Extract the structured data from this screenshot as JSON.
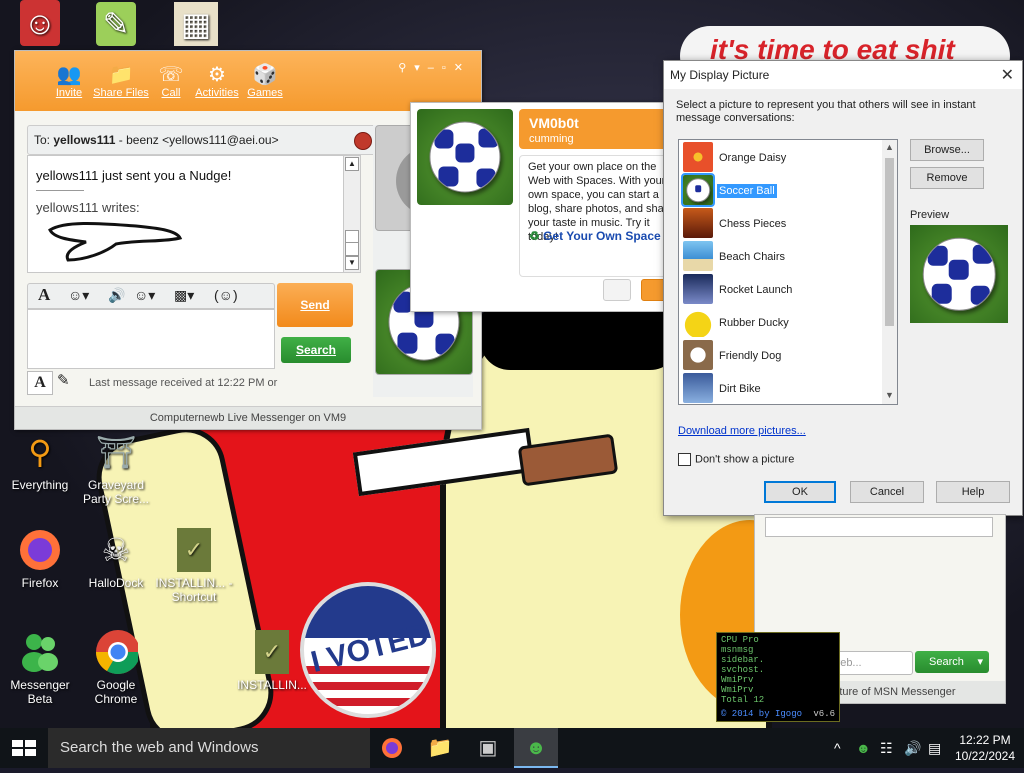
{
  "wallpaper": {
    "sign_text": "it's time to eat shit",
    "badge_text": "I VOTED"
  },
  "desktop_icons": [
    {
      "name": "everything",
      "label": "Everything",
      "icon": "magnifier-icon"
    },
    {
      "name": "graveyard",
      "label": "Graveyard Party Scre...",
      "icon": "graveyard-icon"
    },
    {
      "name": "firefox",
      "label": "Firefox",
      "icon": "firefox-icon"
    },
    {
      "name": "hallodock",
      "label": "HalloDock",
      "icon": "skull-icon"
    },
    {
      "name": "installing-shortcut",
      "label": "INSTALLIN... - Shortcut",
      "icon": "script-icon"
    },
    {
      "name": "messenger-beta",
      "label": "Messenger Beta",
      "icon": "messenger-icon"
    },
    {
      "name": "google-chrome",
      "label": "Google Chrome",
      "icon": "chrome-icon"
    },
    {
      "name": "installing",
      "label": "INSTALLIN...",
      "icon": "script-icon"
    }
  ],
  "messenger": {
    "toolbar": [
      {
        "label": "Invite",
        "icon": "invite-icon"
      },
      {
        "label": "Share Files",
        "icon": "folder-icon"
      },
      {
        "label": "Call",
        "icon": "phone-icon"
      },
      {
        "label": "Activities",
        "icon": "activities-icon"
      },
      {
        "label": "Games",
        "icon": "games-icon"
      }
    ],
    "to_label": "To:",
    "to_name": "yellows111",
    "to_rest": "- beenz <yellows111@aei.ou>",
    "nudge_text": "yellows111 just sent you a Nudge!",
    "writes_text": "yellows111 writes:",
    "send_label": "Send",
    "search_label": "Search",
    "last_message": "Last message received at 12:22 PM or",
    "status_bar": "Computernewb Live Messenger on VM9"
  },
  "popup": {
    "name": "VM0b0t",
    "status": "cumming",
    "body": "Get your own place on the Web with Spaces. With your own space, you can start a blog, share photos, and share your taste in music. Try it today!",
    "link": "Get Your Own Space"
  },
  "dialog": {
    "title": "My Display Picture",
    "description": "Select a picture to represent you that others will see in instant message conversations:",
    "pictures": [
      {
        "label": "Orange Daisy",
        "color": "#e8502a"
      },
      {
        "label": "Soccer Ball",
        "color": "#5b9d33",
        "selected": true
      },
      {
        "label": "Chess Pieces",
        "color": "#8a3a1a"
      },
      {
        "label": "Beach Chairs",
        "color": "#3d8fd4"
      },
      {
        "label": "Rocket Launch",
        "color": "#2a3c8a"
      },
      {
        "label": "Rubber Ducky",
        "color": "#f4d416"
      },
      {
        "label": "Friendly Dog",
        "color": "#8a6a4a"
      },
      {
        "label": "Dirt Bike",
        "color": "#3a5a9a"
      }
    ],
    "browse_label": "Browse...",
    "remove_label": "Remove",
    "preview_label": "Preview",
    "download_link": "Download more pictures...",
    "dont_show_label": "Don't show a picture",
    "ok_label": "OK",
    "cancel_label": "Cancel",
    "help_label": "Help"
  },
  "fragment": {
    "search_placeholder": "Search the web...",
    "search_label": "Search",
    "footer": "The Future of MSN Messenger"
  },
  "gadget": {
    "lines": [
      "CPU Pro",
      "msnmsg",
      "sidebar.",
      "svchost.",
      "WmiPrv",
      "WmiPrv",
      "Total 12"
    ],
    "credit": "© 2014 by Igogo",
    "version": "v6.6"
  },
  "taskbar": {
    "search_placeholder": "Search the web and Windows",
    "time": "12:22 PM",
    "date": "10/22/2024"
  }
}
